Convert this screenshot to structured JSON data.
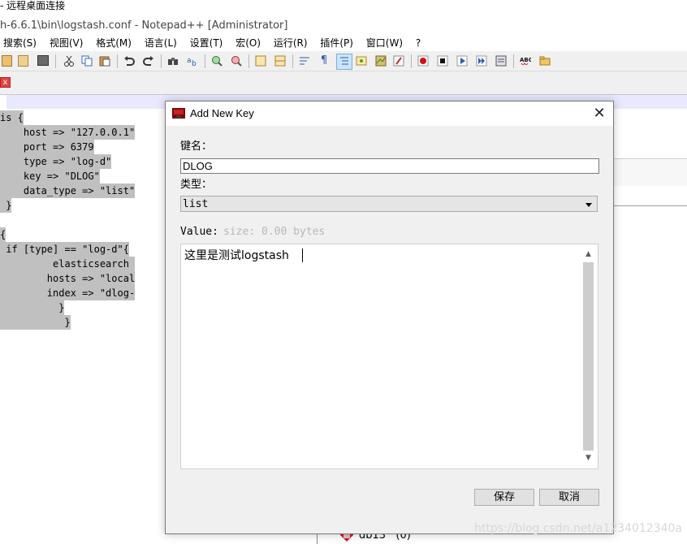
{
  "rdp_window": {
    "title": "- 远程桌面连接"
  },
  "notepad": {
    "title": "h-6.6.1\\bin\\logstash.conf - Notepad++ [Administrator]",
    "menu": [
      "搜索(S)",
      "视图(V)",
      "格式(M)",
      "语言(L)",
      "设置(T)",
      "宏(O)",
      "运行(R)",
      "插件(P)",
      "窗口(W)",
      "?"
    ],
    "tab_close": "x",
    "code_lines": [
      "is {",
      "    host => \"127.0.0.1\"",
      "    port => 6379",
      "    type => \"log-d\"",
      "    key => \"DLOG\"",
      "    data_type => \"list\"",
      " }",
      "{",
      " if [type] == \"log-d\"{",
      "         elasticsearch ",
      "        hosts => \"local",
      "        index => \"dlog-",
      "          }",
      "           }"
    ]
  },
  "background": {
    "db_item": "db13",
    "db_count": "(0)",
    "watermark": "https://blog.csdn.net/a1234012340a"
  },
  "dialog": {
    "title": "Add New Key",
    "close_glyph": "✕",
    "key_name_label": "键名：",
    "key_name_value": "DLOG",
    "type_label": "类型：",
    "type_value": "list",
    "value_label": "Value:",
    "size_label": "size: 0.00 bytes",
    "value_text": "这里是测试logstash",
    "save_label": "保存",
    "cancel_label": "取消",
    "scroll_up_glyph": "▲",
    "scroll_down_glyph": "▼"
  }
}
